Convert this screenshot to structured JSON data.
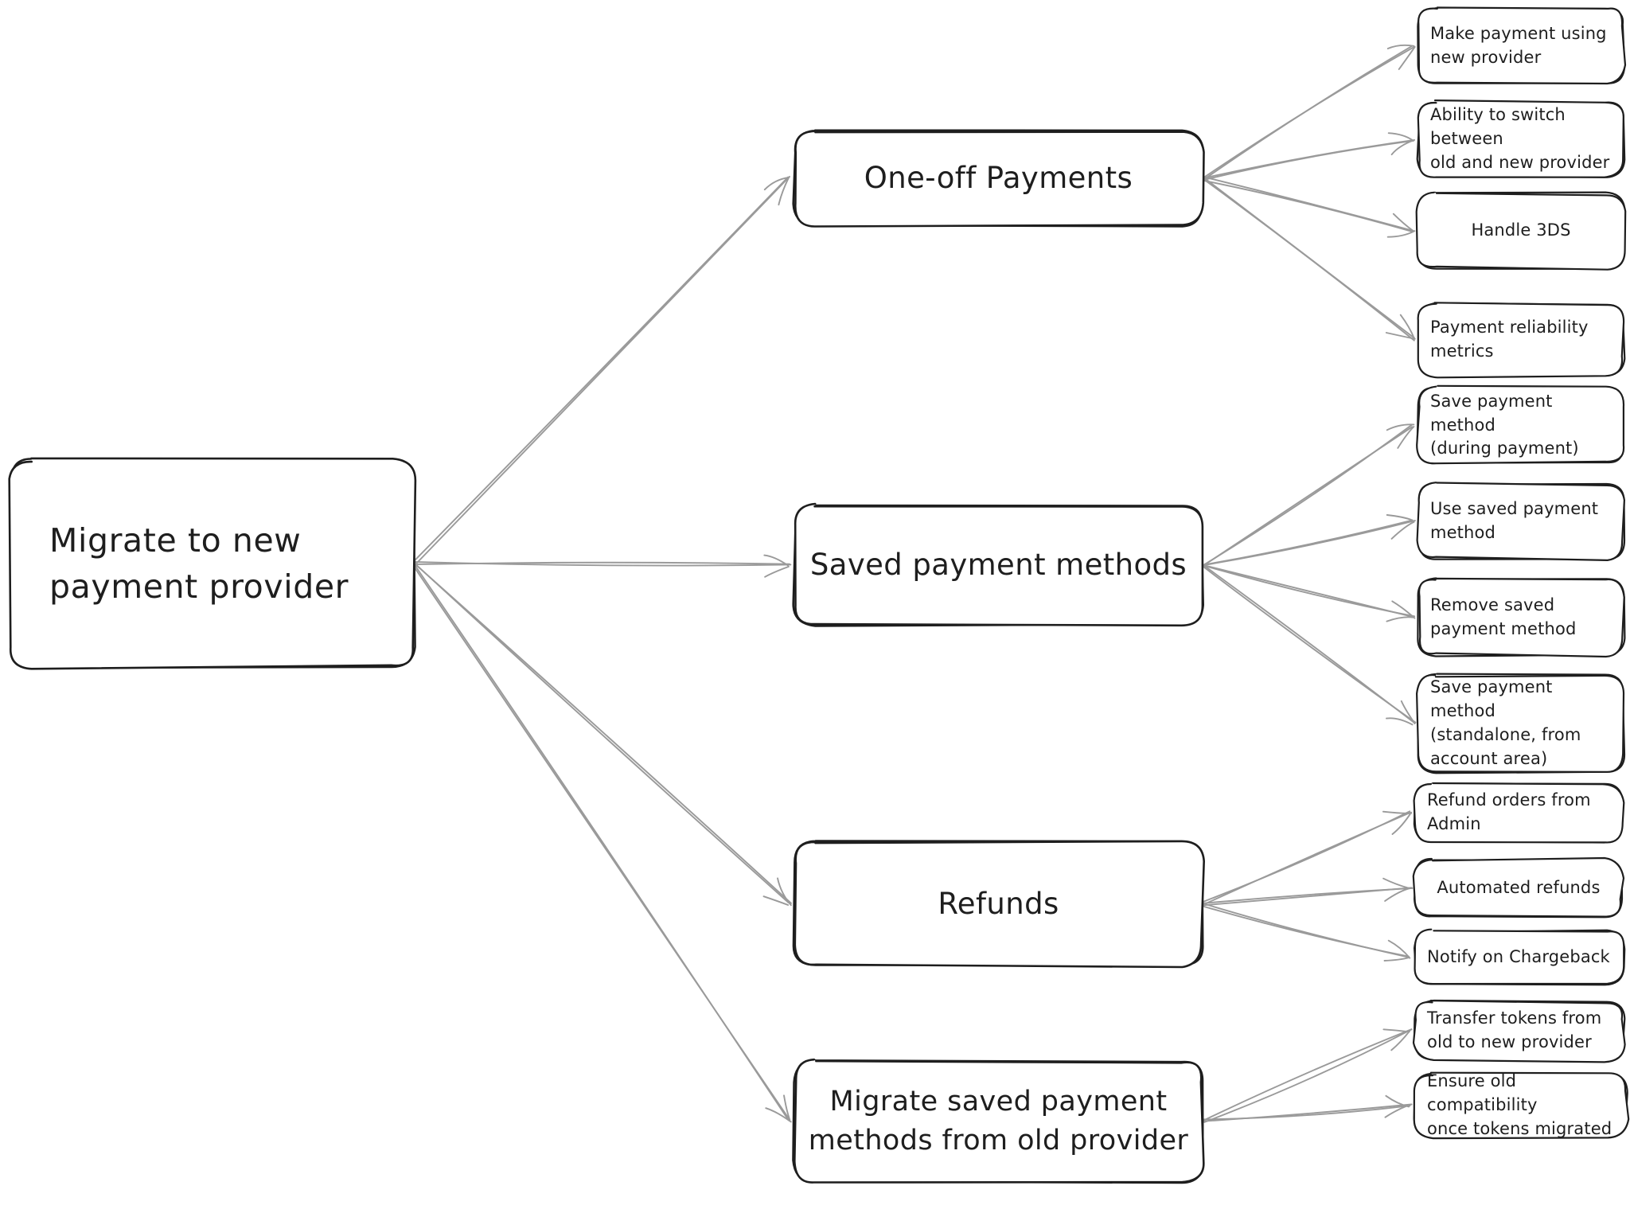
{
  "diagram": {
    "type": "mind-map",
    "title": "Migrate to new payment provider",
    "style": {
      "background": "#ffffff",
      "node_stroke": "#1e1e1e",
      "edge_stroke": "#9a9a9a",
      "text_color": "#1e1e1e"
    },
    "root": {
      "id": "root",
      "label": "Migrate to new\npayment provider"
    },
    "branches": [
      {
        "id": "one-off-payments",
        "label": "One-off Payments",
        "leaves": [
          {
            "id": "make-payment-new-provider",
            "label": "Make payment using\nnew provider"
          },
          {
            "id": "switch-old-new-provider",
            "label": "Ability to switch between\nold and new provider"
          },
          {
            "id": "handle-3ds",
            "label": "Handle 3DS"
          },
          {
            "id": "payment-reliability-metrics",
            "label": "Payment reliability\nmetrics"
          }
        ]
      },
      {
        "id": "saved-payment-methods",
        "label": "Saved payment methods",
        "leaves": [
          {
            "id": "save-payment-method-during-payment",
            "label": "Save payment method\n(during payment)"
          },
          {
            "id": "use-saved-payment-method",
            "label": "Use saved payment\nmethod"
          },
          {
            "id": "remove-saved-payment-method",
            "label": "Remove saved\npayment method"
          },
          {
            "id": "save-payment-method-standalone",
            "label": "Save payment method\n(standalone, from\naccount area)"
          }
        ]
      },
      {
        "id": "refunds",
        "label": "Refunds",
        "leaves": [
          {
            "id": "refund-orders-from-admin",
            "label": "Refund orders from\nAdmin"
          },
          {
            "id": "automated-refunds",
            "label": "Automated refunds"
          },
          {
            "id": "notify-on-chargeback",
            "label": "Notify on Chargeback"
          }
        ]
      },
      {
        "id": "migrate-saved-payment-methods",
        "label": "Migrate saved payment\nmethods from old provider",
        "leaves": [
          {
            "id": "transfer-tokens-old-to-new",
            "label": "Transfer tokens from\nold to new provider"
          },
          {
            "id": "ensure-old-compatibility",
            "label": "Ensure old compatibility\nonce tokens migrated"
          }
        ]
      }
    ]
  }
}
